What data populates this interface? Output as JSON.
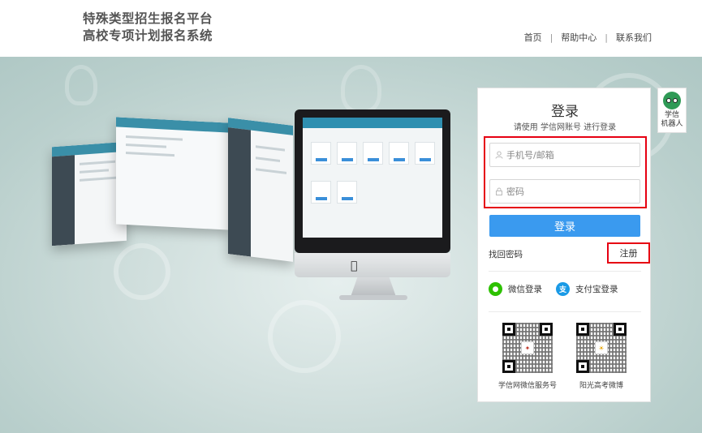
{
  "header": {
    "brand_line1": "特殊类型招生报名平台",
    "brand_line2": "高校专项计划报名系统",
    "nav": [
      {
        "label": "首页"
      },
      {
        "label": "帮助中心"
      },
      {
        "label": "联系我们"
      }
    ]
  },
  "login": {
    "title": "登录",
    "subtitle": "请使用 学信网账号 进行登录",
    "username_placeholder": "手机号/邮箱",
    "password_placeholder": "密码",
    "submit_label": "登录",
    "find_password": "找回密码",
    "register": "注册",
    "social": [
      {
        "label": "微信登录",
        "color": "#2dc100",
        "icon": "wechat-icon"
      },
      {
        "label": "支付宝登录",
        "color": "#1a9ae6",
        "icon": "alipay-icon"
      }
    ],
    "qr": [
      {
        "caption": "学信网微信服务号"
      },
      {
        "caption": "阳光高考微博"
      }
    ]
  },
  "robot": {
    "line1": "学信",
    "line2": "机器人"
  },
  "colors": {
    "accent": "#3a9aef",
    "highlight": "#e60012",
    "banner": "#b9cfcc"
  }
}
